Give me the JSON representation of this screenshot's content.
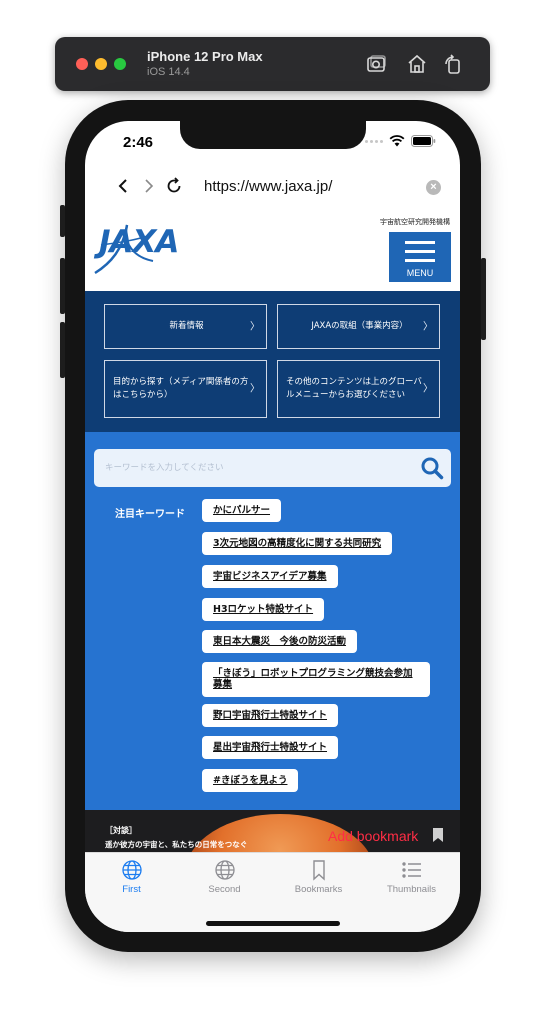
{
  "simulator": {
    "device_name": "iPhone 12 Pro Max",
    "os_version": "iOS 14.4",
    "icons": [
      "screenshot-icon",
      "home-icon",
      "rotate-icon"
    ]
  },
  "status_bar": {
    "time": "2:46"
  },
  "browser": {
    "url": "https://www.jaxa.jp/",
    "icons": [
      "back-icon",
      "forward-icon",
      "reload-icon",
      "clear-icon"
    ]
  },
  "site": {
    "org_name": "宇宙航空研究開発機構",
    "menu_label": "MENU",
    "quick_links": [
      "新着情報",
      "JAXAの取組（事業内容）",
      "目的から探す（メディア関係者の方はこちらから）",
      "その他のコンテンツは上のグローバルメニューからお選びください"
    ],
    "search": {
      "placeholder": "キーワードを入力してください"
    },
    "keywords_label": "注目キーワード",
    "keywords": [
      "かにパルサー",
      "3次元地図の高精度化に関する共同研究",
      "宇宙ビジネスアイデア募集",
      "H3ロケット特設サイト",
      "東日本大震災　今後の防災活動",
      "「きぼう」ロボットプログラミング競技会参加募集",
      "野口宇宙飛行士特設サイト",
      "星出宇宙飛行士特設サイト",
      "#きぼうを見よう"
    ],
    "feature": {
      "tag": "［対談］",
      "caption": "遥か彼方の宇宙と、私たちの日常をつなぐ"
    }
  },
  "add_bookmark_label": "Add bookmark",
  "tabs": [
    {
      "label": "First",
      "icon": "globe-icon",
      "active": true
    },
    {
      "label": "Second",
      "icon": "globe-icon",
      "active": false
    },
    {
      "label": "Bookmarks",
      "icon": "bookmark-icon",
      "active": false
    },
    {
      "label": "Thumbnails",
      "icon": "list-icon",
      "active": false
    }
  ],
  "colors": {
    "jaxa_blue": "#1f66b5",
    "dark_navy": "#0e3d75",
    "search_blue": "#2673d0",
    "tab_active": "#1b7cf0",
    "bookmark_red": "#ff2d45"
  }
}
